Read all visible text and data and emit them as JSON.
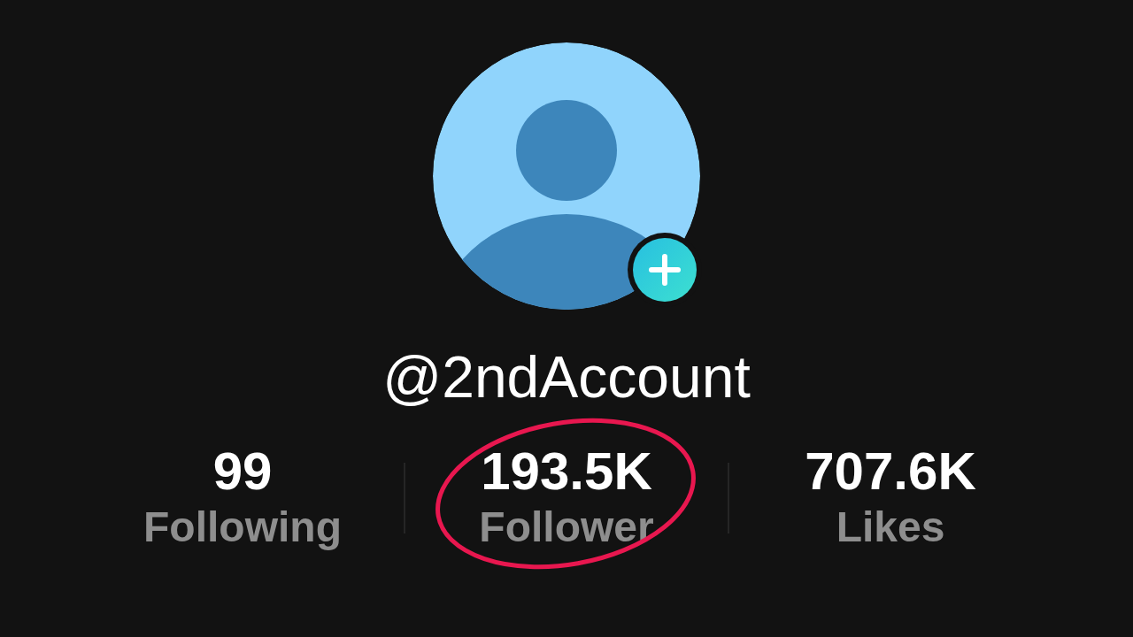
{
  "profile": {
    "username": "@2ndAccount"
  },
  "stats": [
    {
      "value": "99",
      "label": "Following",
      "highlighted": false
    },
    {
      "value": "193.5K",
      "label": "Follower",
      "highlighted": true
    },
    {
      "value": "707.6K",
      "label": "Likes",
      "highlighted": false
    }
  ]
}
